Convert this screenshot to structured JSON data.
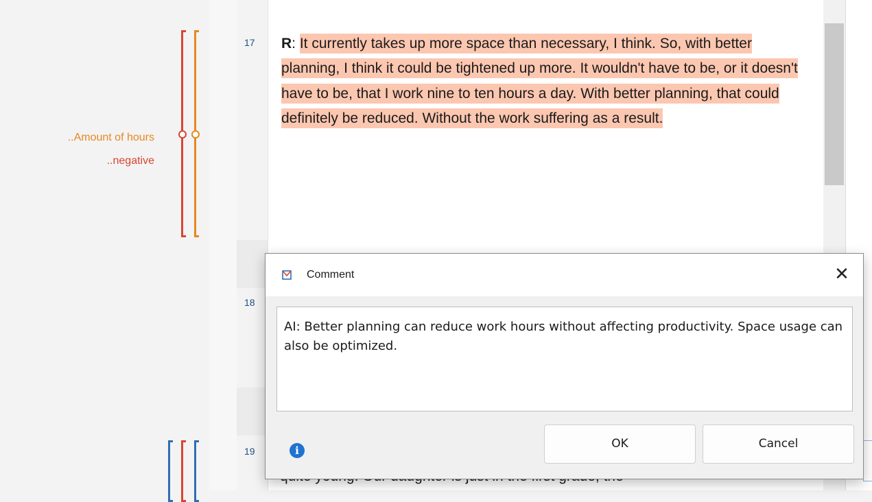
{
  "colors": {
    "code_red": "#d9452f",
    "code_orange": "#e8871e",
    "code_blue": "#2f6db5",
    "highlight": "#fcc7b0",
    "info_blue": "#1f73d1"
  },
  "margin": {
    "codes": [
      {
        "label": "..Amount of hours",
        "color": "#e8871e"
      },
      {
        "label": "..negative",
        "color": "#d9452f"
      }
    ]
  },
  "document": {
    "line_numbers": [
      "17",
      "18",
      "19"
    ],
    "paragraph_17": {
      "speaker": "R",
      "text": "It currently takes up more space than necessary, I think. So, with better planning, I think it could be tightened up more. It wouldn't have to be, or it doesn't have to be, that I work nine to ten hours a day. With better planning, that could definitely be reduced. Without the work suffering as a result."
    },
    "paragraph_19_visible": "quite young. Our daughter is just in the first grade, the"
  },
  "dialog": {
    "title": "Comment",
    "logo_icon": "maxqda-logo-icon",
    "close_glyph": "✕",
    "comment_text": "AI: Better planning can reduce work hours without affecting productivity. Space usage can also be optimized.",
    "info_glyph": "i",
    "ok_label": "OK",
    "cancel_label": "Cancel"
  }
}
